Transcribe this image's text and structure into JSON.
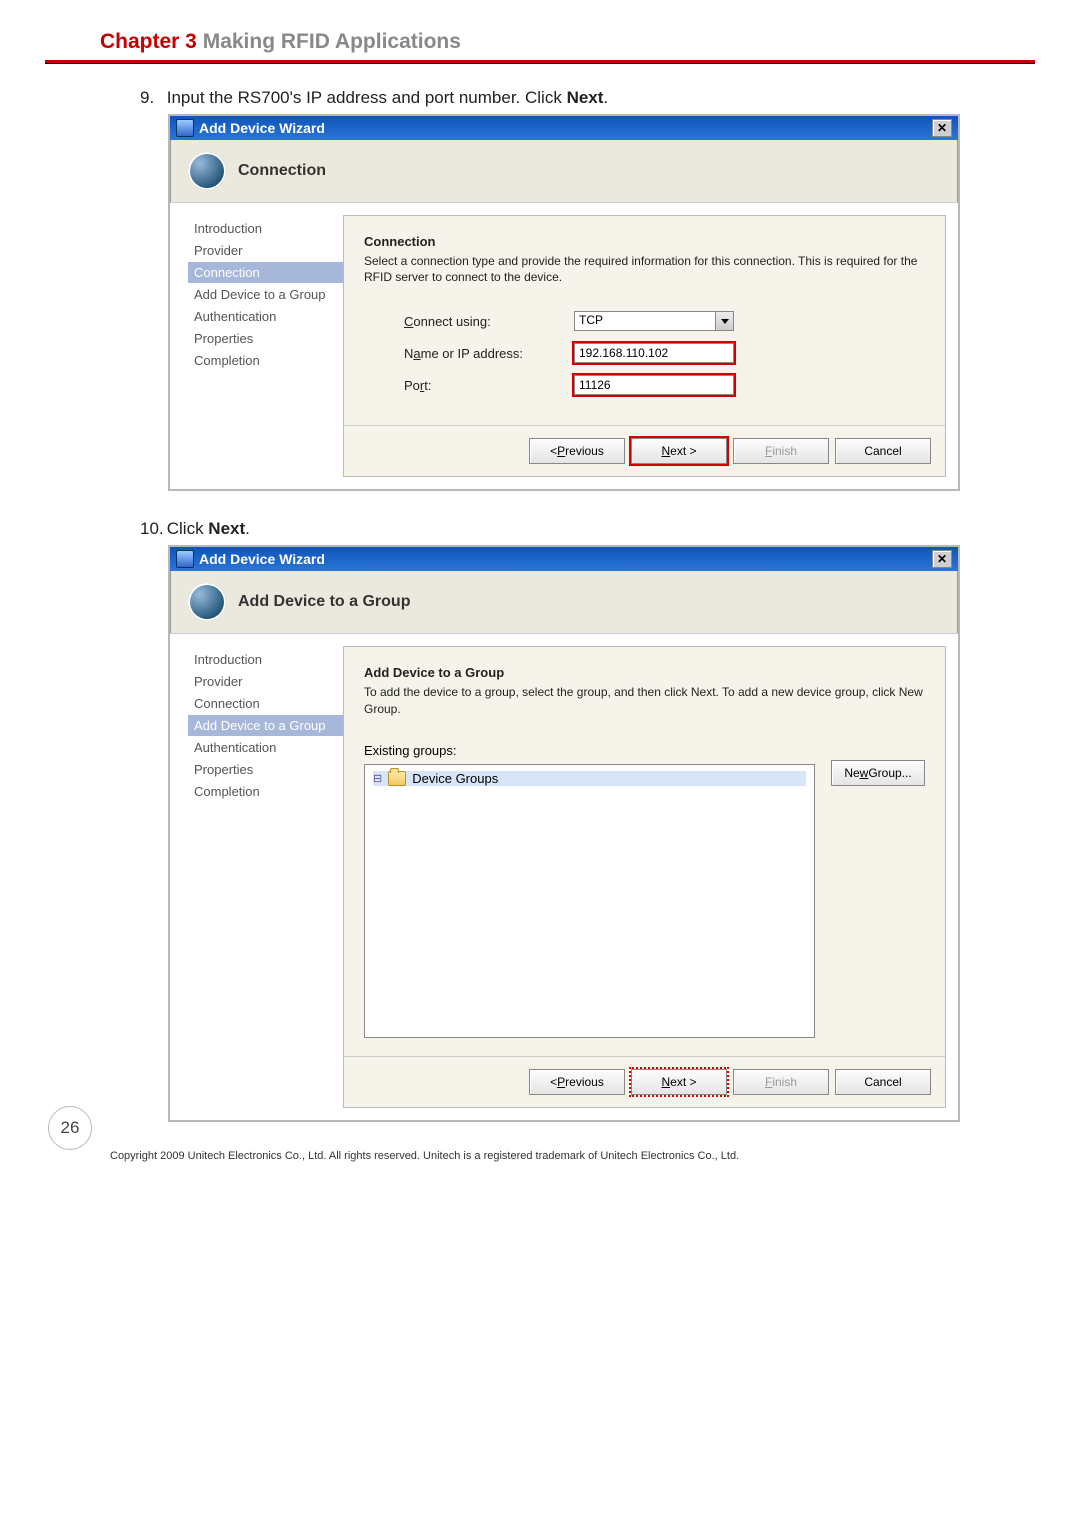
{
  "chapter": {
    "label": "Chapter 3",
    "title": "Making RFID Applications"
  },
  "step9": {
    "num": "9.",
    "text_a": "Input the RS700's IP address and port number. Click ",
    "text_b": "Next",
    "text_c": "."
  },
  "step10": {
    "num": "10.",
    "text_a": "Click ",
    "text_b": "Next",
    "text_c": "."
  },
  "wiz1": {
    "title": "Add Device Wizard",
    "header": "Connection",
    "nav": [
      "Introduction",
      "Provider",
      "Connection",
      "Add Device to a Group",
      "Authentication",
      "Properties",
      "Completion"
    ],
    "nav_active_index": 2,
    "section_title": "Connection",
    "section_desc": "Select a connection type and provide the required information for this connection. This is required for the RFID server to connect to the device.",
    "lbl_connect": "Connect using:",
    "val_connect": "TCP",
    "lbl_ip": "Name or IP address:",
    "val_ip": "192.168.110.102",
    "lbl_port": "Port:",
    "val_port": "11126",
    "btns": {
      "prev": "< Previous",
      "next": "Next >",
      "finish": "Finish",
      "cancel": "Cancel"
    }
  },
  "wiz2": {
    "title": "Add Device Wizard",
    "header": "Add Device to a Group",
    "nav": [
      "Introduction",
      "Provider",
      "Connection",
      "Add Device to a Group",
      "Authentication",
      "Properties",
      "Completion"
    ],
    "nav_active_index": 3,
    "section_title": "Add Device to a Group",
    "section_desc": "To add the device to a group, select the group, and then click Next. To add a new device group, click New Group.",
    "lbl_existing": "Existing groups:",
    "tree_root": "Device Groups",
    "btn_newgroup": "New Group...",
    "btns": {
      "prev": "< Previous",
      "next": "Next >",
      "finish": "Finish",
      "cancel": "Cancel"
    }
  },
  "footer": {
    "page_num": "26",
    "copyright": "Copyright 2009 Unitech Electronics Co., Ltd. All rights reserved. Unitech is a registered trademark of Unitech Electronics Co., Ltd."
  }
}
